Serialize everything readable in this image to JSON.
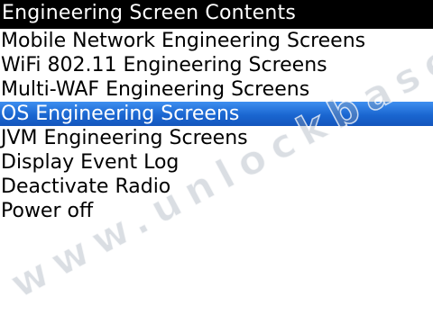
{
  "title_bar": {
    "title": "Engineering Screen Contents"
  },
  "menu": {
    "selected_index": 3,
    "items": [
      {
        "label": "Mobile Network Engineering Screens"
      },
      {
        "label": "WiFi 802.11 Engineering Screens"
      },
      {
        "label": "Multi-WAF Engineering Screens"
      },
      {
        "label": "OS Engineering Screens"
      },
      {
        "label": "JVM Engineering Screens"
      },
      {
        "label": "Display Event Log"
      },
      {
        "label": "Deactivate Radio"
      },
      {
        "label": "Power off"
      }
    ]
  },
  "watermark": {
    "text": "www.unlockbase.com"
  },
  "colors": {
    "title_bar_bg": "#000000",
    "title_text": "#ffffff",
    "selection_bg": "#1a66d0",
    "selection_text": "#ffffff",
    "list_text": "#000000",
    "background": "#ffffff"
  }
}
